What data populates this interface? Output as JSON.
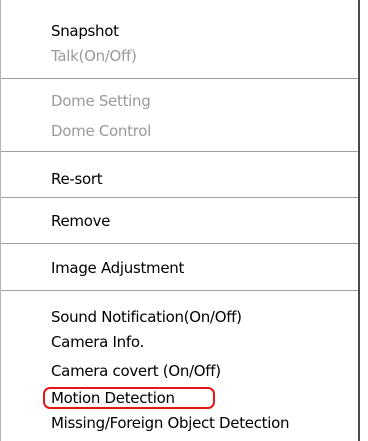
{
  "menu": {
    "groups": [
      {
        "items": [
          {
            "label": "Snapshot",
            "enabled": true
          },
          {
            "label": "Talk(On/Off)",
            "enabled": false
          }
        ]
      },
      {
        "items": [
          {
            "label": "Dome Setting",
            "enabled": false
          },
          {
            "label": "Dome Control",
            "enabled": false
          }
        ]
      },
      {
        "items": [
          {
            "label": "Re-sort",
            "enabled": true
          }
        ]
      },
      {
        "items": [
          {
            "label": "Remove",
            "enabled": true
          }
        ]
      },
      {
        "items": [
          {
            "label": "Image Adjustment",
            "enabled": true
          }
        ]
      },
      {
        "items": [
          {
            "label": "Sound Notification(On/Off)",
            "enabled": true
          },
          {
            "label": "Camera Info.",
            "enabled": true
          },
          {
            "label": "Camera covert (On/Off)",
            "enabled": true
          },
          {
            "label": "Motion Detection",
            "enabled": true,
            "highlighted": true
          },
          {
            "label": "Missing/Foreign Object Detection",
            "enabled": true
          }
        ]
      }
    ]
  },
  "colors": {
    "text": "#000000",
    "disabled_text": "#9a9a9a",
    "separator": "#a0a0a0",
    "highlight_outline": "#e01818"
  }
}
